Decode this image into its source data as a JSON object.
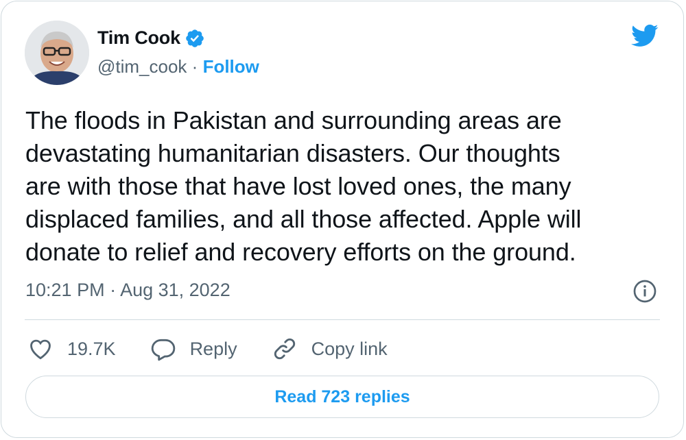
{
  "author": {
    "name": "Tim Cook",
    "handle": "@tim_cook",
    "separator": "·",
    "follow_label": "Follow"
  },
  "tweet": {
    "text": "The floods in Pakistan and surrounding areas are\ndevastating humanitarian disasters. Our thoughts\nare with those that have lost loved ones, the many\ndisplaced families, and all those affected. Apple will\ndonate to relief and recovery efforts on the ground.",
    "timestamp": "10:21 PM · Aug 31, 2022"
  },
  "actions": {
    "likes": "19.7K",
    "reply_label": "Reply",
    "copy_link_label": "Copy link"
  },
  "read_replies_label": "Read 723 replies",
  "colors": {
    "accent": "#1d9bf0",
    "text": "#0f1419",
    "secondary": "#536471",
    "border": "#cfd9de"
  },
  "icons": [
    "avatar",
    "verified-badge-icon",
    "twitter-bird-icon",
    "info-icon",
    "heart-icon",
    "reply-bubble-icon",
    "link-icon"
  ]
}
